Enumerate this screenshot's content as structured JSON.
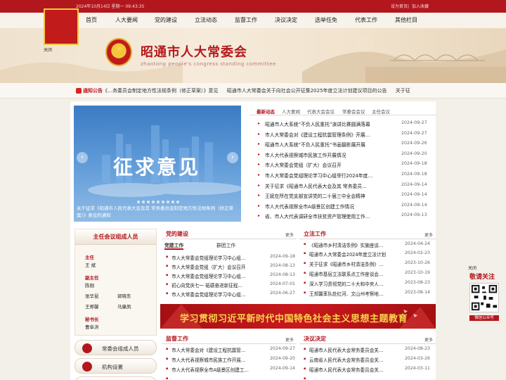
{
  "topbar": {
    "datetime": "2024年10月14日 星期一 09:43:35",
    "links": [
      "设为首页",
      "加入收藏"
    ]
  },
  "badge": {
    "line1": "",
    "line2": "",
    "close": "关闭"
  },
  "nav": {
    "items": [
      "首页",
      "人大要闻",
      "党的建设",
      "立法动态",
      "监督工作",
      "决议决定",
      "选举任免",
      "代表工作",
      "其他栏目"
    ]
  },
  "header": {
    "title": "昭通市人大常委会",
    "subtitle": "zhaotong people's congress standing committee"
  },
  "notice": {
    "label": "通知公告",
    "items": [
      "《…务委员会制定地方性法规条例（修正草案）》意见",
      "昭通市人大常委会关于向社会公开征集2025年度立法计划建议项目的公告",
      "关于征"
    ]
  },
  "slider": {
    "headline": "征求意见",
    "caption": "关于征求《昭通市人民代表大会及其 常务委员会制定地方性法规条例（修正草案）》意见的通知"
  },
  "news": {
    "tabs": [
      "最新动态",
      "人大要闻",
      "代表大会会议",
      "常委会会议",
      "主任会议"
    ],
    "items": [
      {
        "title": "昭通市人大系统“不负人民重托”演讲比赛圆满落幕",
        "date": "2024-09-27"
      },
      {
        "title": "市人大常委会对《建设工程抗震管理条例》开展…",
        "date": "2024-09-27"
      },
      {
        "title": "昭通市人大系统“不负人民重托”书画摄影展开展",
        "date": "2024-09-26"
      },
      {
        "title": "市人大代表视察城市民族工作开展情况",
        "date": "2024-09-20"
      },
      {
        "title": "市人大常委会党组（扩大）会议召开",
        "date": "2024-09-18"
      },
      {
        "title": "市人大常委会党组理论学习中心组举行2024年度…",
        "date": "2024-09-18"
      },
      {
        "title": "关于征求《昭通市人民代表大会及其 常务委员…",
        "date": "2024-09-14"
      },
      {
        "title": "王斌在所在党支部宣讲党的二十届三中全会精神",
        "date": "2024-09-14"
      },
      {
        "title": "市人大代表视察全市A级景区创建工作情况",
        "date": "2024-09-14"
      },
      {
        "title": "省、市人大代表调研全市扶贫资产管理使用工作…",
        "date": "2024-09-13"
      }
    ]
  },
  "members": {
    "header": "主任会议组成人员",
    "director_label": "主任",
    "director": [
      "王 斌"
    ],
    "deputy_label": "副主任",
    "deputies": [
      "陈刚",
      "",
      "张华昆",
      "郭晓东",
      "王郑馨",
      "马康凤"
    ],
    "secretary_label": "秘书长",
    "secretary": [
      "曹阜洪"
    ]
  },
  "sidebuttons": [
    "常委会组成人员",
    "机构设置",
    ""
  ],
  "party": {
    "title": "党的建设",
    "more": "更多",
    "subtabs": [
      "党建工作",
      "群团工作"
    ],
    "items": [
      {
        "title": "市人大常委会党组理论学习中心组…",
        "date": "2024-09-18"
      },
      {
        "title": "市人大常委会党组（扩大）会议召开",
        "date": "2024-08-13"
      },
      {
        "title": "市人大常委会党组理论学习中心组…",
        "date": "2024-08-13"
      },
      {
        "title": "初心向党庆七一 砥砺奋进新征程…",
        "date": "2024-07-01"
      },
      {
        "title": "市人大常委会党组理论学习中心组…",
        "date": "2024-06-27"
      }
    ]
  },
  "legislation": {
    "title": "立法工作",
    "more": "更多",
    "items": [
      {
        "title": "《昭通市乡村清洁条例》实施座谈…",
        "date": "2024-04-24"
      },
      {
        "title": "昭通市人大常委会2024年度立法计划",
        "date": "2024-02-23"
      },
      {
        "title": "关于征求《昭通市乡村清洁条例》…",
        "date": "2023-10-26"
      },
      {
        "title": "昭通市基层立法联系点工作座谈会…",
        "date": "2023-10-19"
      },
      {
        "title": "深入学习贯彻党的二十大和中央人…",
        "date": "2023-08-23"
      },
      {
        "title": "王郑馨率队赴红河、文山州考察地…",
        "date": "2023-08-14"
      }
    ]
  },
  "redbanner": {
    "text": "学习贯彻习近平新时代中国特色社会主义思想主题教育"
  },
  "supervision": {
    "title": "监督工作",
    "more": "更多",
    "items": [
      {
        "title": "市人大常委会对《建设工程抗震管…",
        "date": "2024-09-27"
      },
      {
        "title": "市人大代表视察城市民族工作开展…",
        "date": "2024-09-20"
      },
      {
        "title": "市人大代表视察全市A级景区创建工…",
        "date": "2024-09-14"
      },
      {
        "title": "",
        "date": ""
      }
    ]
  },
  "resolutions": {
    "title": "决议决定",
    "more": "更多",
    "items": [
      {
        "title": "昭通市人民代表大会常务委员会关…",
        "date": "2024-08-23"
      },
      {
        "title": "云南省人民代表大会常务委员会关…",
        "date": "2024-03-26"
      },
      {
        "title": "昭通市人民代表大会常务委员会关…",
        "date": "2024-03-11"
      },
      {
        "title": "",
        "date": ""
      }
    ]
  },
  "follow": {
    "close": "关闭",
    "title": "敬请关注",
    "caption": "微信公众号"
  },
  "colors": {
    "brand_red": "#b3171e",
    "gold": "#f9d54c",
    "slider_blue": "#3c7bc4"
  }
}
